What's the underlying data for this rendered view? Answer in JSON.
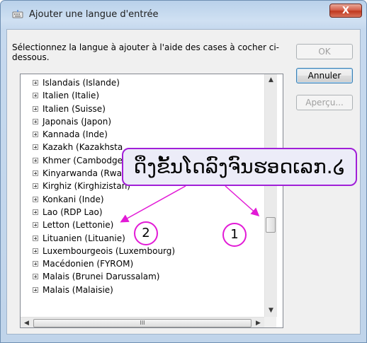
{
  "window": {
    "title": "Ajouter une langue d'entrée",
    "close_label": "X"
  },
  "instructions": "Sélectionnez la langue à ajouter à l'aide des cases à cocher ci-dessous.",
  "buttons": {
    "ok": "OK",
    "cancel": "Annuler",
    "preview": "Aperçu..."
  },
  "list": {
    "items": [
      "Islandais (Islande)",
      "Italien (Italie)",
      "Italien (Suisse)",
      "Japonais (Japon)",
      "Kannada (Inde)",
      "Kazakh (Kazakhsta",
      "Khmer (Cambodge",
      "Kinyarwanda (Rwa",
      "Kirghiz (Kirghizistan)",
      "Konkani (Inde)",
      "Lao (RDP Lao)",
      "Letton (Lettonie)",
      "Lituanien (Lituanie)",
      "Luxembourgeois (Luxembourg)",
      "Macédonien (FYROM)",
      "Malais (Brunei Darussalam)",
      "Malais (Malaisie)"
    ]
  },
  "scrollbar": {
    "up": "▲",
    "down": "▼",
    "left": "◀",
    "right": "▶",
    "grip": "III"
  },
  "annotation": {
    "callout_text": "ດຶງຂັ້ນໂດລົງຈົນຮອດເລກ.໒",
    "badge_1": "1",
    "badge_2": "2",
    "color": "#e21ad6",
    "border_color": "#a11fd8"
  }
}
